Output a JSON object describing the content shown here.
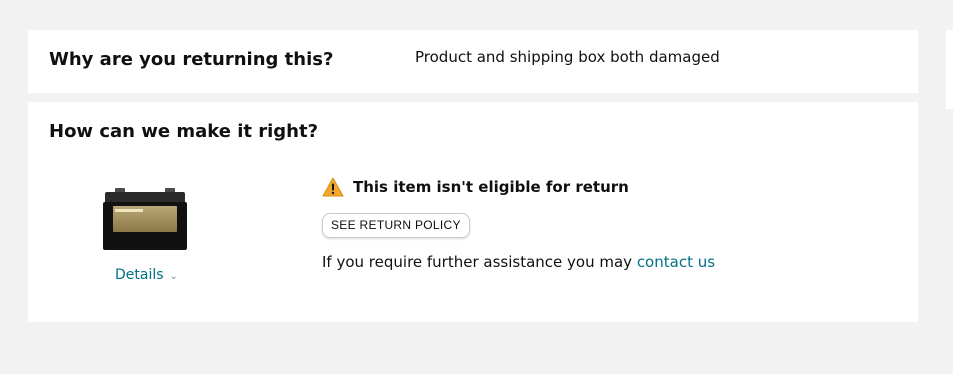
{
  "reason_section": {
    "heading": "Why are you returning this?",
    "value": "Product and shipping box both damaged"
  },
  "remedy_section": {
    "heading": "How can we make it right?",
    "product": {
      "details_label": "Details"
    },
    "eligibility": {
      "warning_icon": "warning-triangle-icon",
      "warning_text": "This item isn't eligible for return",
      "policy_button": "SEE RETURN POLICY",
      "assist_prefix": "If you require further assistance you may ",
      "assist_link": "contact us"
    }
  },
  "colors": {
    "link": "#007185",
    "warning": "#f0a930",
    "page_bg": "#f2f2f2"
  }
}
